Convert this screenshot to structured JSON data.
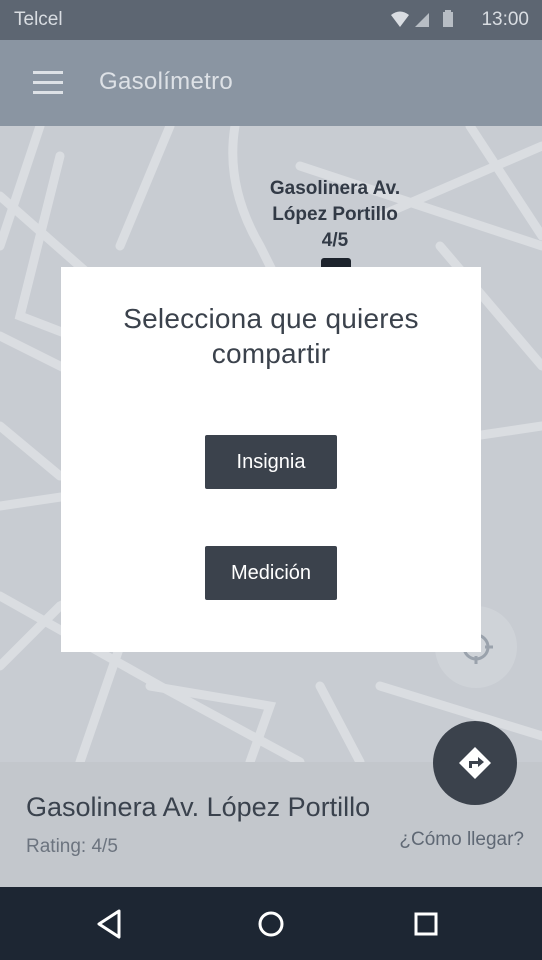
{
  "status_bar": {
    "carrier": "Telcel",
    "time": "13:00"
  },
  "app_bar": {
    "title": "Gasolímetro",
    "menu_icon": "hamburger-menu-icon"
  },
  "map": {
    "pin_label": [
      "Gasolinera Av.",
      "López Portillo",
      "4/5"
    ],
    "pin_icon": "gas-pump-icon",
    "locate_icon": "crosshair-location-icon"
  },
  "info_panel": {
    "station_name": "Gasolinera Av. López Portillo",
    "rating": "Rating: 4/5",
    "how_to_link": "¿Cómo llegar?",
    "directions_icon": "directions-icon"
  },
  "dialog": {
    "title": "Selecciona que quieres compartir",
    "buttons": [
      "Insignia",
      "Medición"
    ]
  },
  "nav_bar": {
    "icons": [
      "back-icon",
      "home-icon",
      "recents-icon"
    ]
  },
  "colors": {
    "status_bar": "#5d6672",
    "app_bar": "#8a95a2",
    "map": "#c8ccd2",
    "dialog_button": "#3b424c",
    "nav_bar": "#1d2633"
  }
}
